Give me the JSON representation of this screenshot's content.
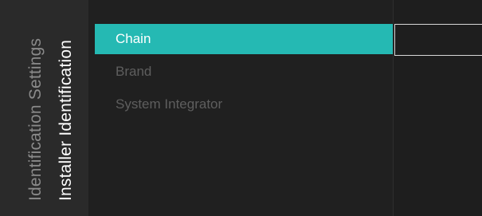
{
  "breadcrumb": {
    "parent": "Identification Settings",
    "current": "Installer Identification"
  },
  "menu": {
    "items": [
      {
        "label": "Chain",
        "selected": true
      },
      {
        "label": "Brand",
        "selected": false
      },
      {
        "label": "System Integrator",
        "selected": false
      }
    ]
  },
  "detail": {
    "value": ""
  },
  "colors": {
    "accent": "#25b9b3",
    "background": "#151515",
    "inactive_text": "#5e5e5e"
  }
}
